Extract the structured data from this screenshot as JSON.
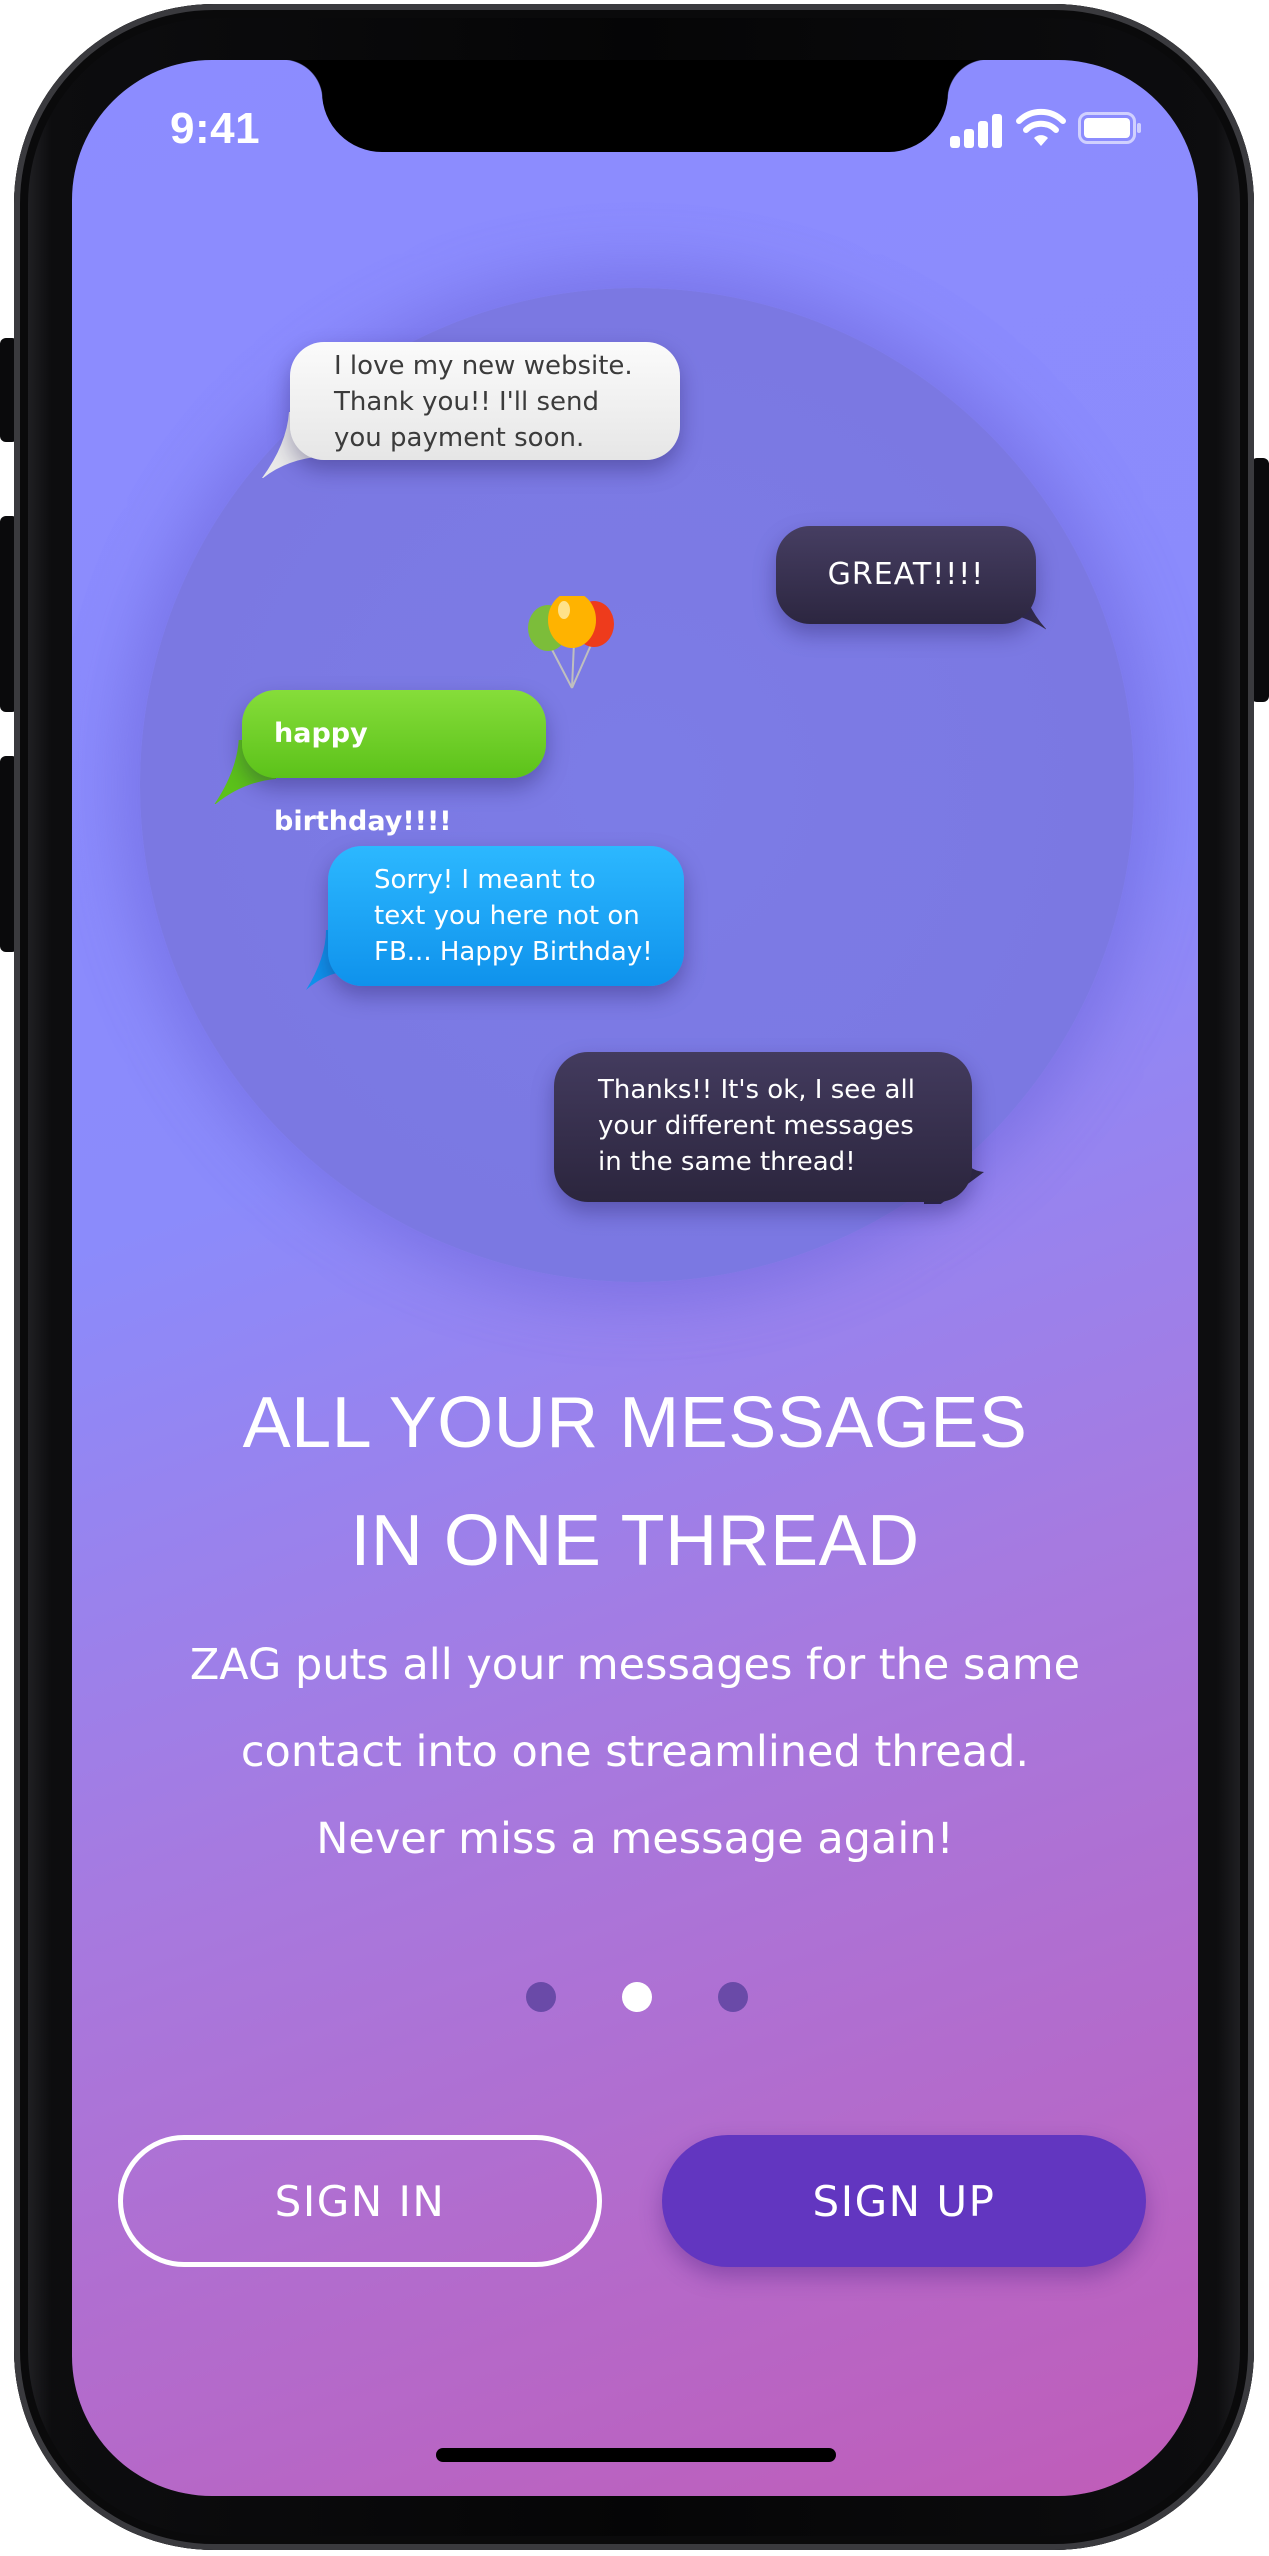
{
  "status_bar": {
    "time": "9:41"
  },
  "chat_bubbles": [
    {
      "text": "I love my new website.\nThank you!! I'll send\nyou payment soon.",
      "style": "gray"
    },
    {
      "text": "GREAT!!!!",
      "style": "dark"
    },
    {
      "text": "happy birthday!!!!",
      "style": "green"
    },
    {
      "text": "Sorry! I meant to\ntext you here not on\nFB... Happy Birthday!",
      "style": "blue"
    },
    {
      "text": "Thanks!!  It's ok, I see all\nyour different messages\nin the same thread!",
      "style": "dark"
    }
  ],
  "onboarding": {
    "headline_line1": "ALL YOUR MESSAGES",
    "headline_line2": "IN ONE THREAD",
    "body_line1": "ZAG puts all your messages for the same",
    "body_line2": "contact into one streamlined thread.",
    "body_line3": "Never miss a message again!",
    "page_count": 3,
    "active_page": 2
  },
  "buttons": {
    "sign_in": "SIGN IN",
    "sign_up": "SIGN UP"
  },
  "colors": {
    "background_top": "#8c8cff",
    "background_bottom": "#c05cb8",
    "sign_up_button": "#6236c0",
    "bubble_gray": "#efefef",
    "bubble_dark": "#3a3350",
    "bubble_green": "#6ccd24",
    "bubble_blue": "#18a6f6",
    "dot_active": "#ffffff",
    "dot_inactive": "#6a4aa8"
  },
  "icons": [
    "signal-icon",
    "wifi-icon",
    "battery-icon",
    "balloons-icon"
  ]
}
